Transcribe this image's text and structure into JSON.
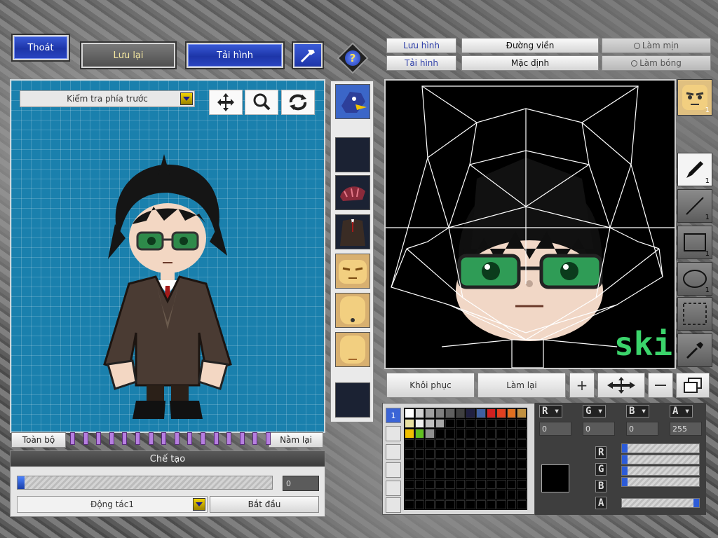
{
  "toolbar": {
    "exit_label": "Thoát",
    "save_label": "Lưu lại",
    "load_label": "Tải hình",
    "help_label": "?"
  },
  "preview": {
    "view_select": "Kiểm tra phía trước",
    "all_label": "Toàn bộ",
    "lie_down_label": "Nằm lại"
  },
  "create": {
    "header": "Chế tạo",
    "frame_value": "0",
    "action_select": "Động tác1",
    "start_label": "Bắt đầu"
  },
  "editor": {
    "save_image": "Lưu hình",
    "load_image": "Tải hình",
    "outline": "Đường viền",
    "default": "Mặc định",
    "smooth": "Làm mịn",
    "shine": "Làm bóng",
    "restore": "Khôi phục",
    "redo": "Làm lại",
    "canvas_text": "ski",
    "face_badge": "1"
  },
  "tools": {
    "pen_count": "1",
    "line_count": "1",
    "rect_count": "1",
    "ellipse_count": "1"
  },
  "color": {
    "r_label": "R",
    "g_label": "G",
    "b_label": "B",
    "a_label": "A",
    "r_value": "0",
    "g_value": "0",
    "b_value": "0",
    "a_value": "255",
    "current_color": "#000000",
    "palette_row1": [
      "#ffffff",
      "#d0d0d0",
      "#a0a0a0",
      "#808080",
      "#606060",
      "#404040",
      "#202040",
      "#4060a0",
      "#d02020",
      "#e04020",
      "#e07020",
      "#c09040"
    ],
    "palette_row2": [
      "#e8e0a0",
      "#f0f0f0",
      "#c0c0c0",
      "#a8a8a8"
    ],
    "palette_row3": [
      "#f0c000",
      "#60c020",
      "#909090"
    ]
  }
}
